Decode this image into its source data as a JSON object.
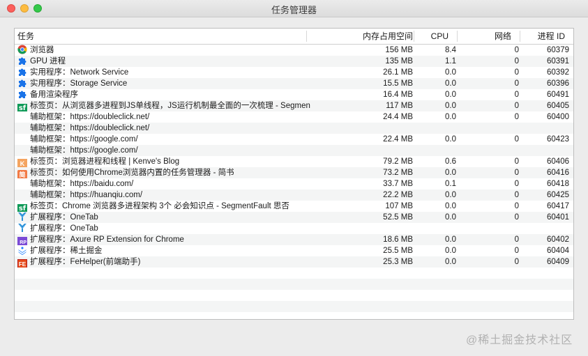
{
  "window": {
    "title": "任务管理器"
  },
  "columns": {
    "task": "任务",
    "memory": "内存占用空间",
    "cpu": "CPU",
    "network": "网络",
    "pid": "进程 ID"
  },
  "rows": [
    {
      "icon": "chrome-icon",
      "task": "浏览器",
      "memory": "156 MB",
      "cpu": "8.4",
      "network": "0",
      "pid": "60379"
    },
    {
      "icon": "puzzle-icon",
      "task": "GPU 进程",
      "memory": "135 MB",
      "cpu": "1.1",
      "network": "0",
      "pid": "60391"
    },
    {
      "icon": "puzzle-icon",
      "task": "实用程序：Network Service",
      "memory": "26.1 MB",
      "cpu": "0.0",
      "network": "0",
      "pid": "60392"
    },
    {
      "icon": "puzzle-icon",
      "task": "实用程序：Storage Service",
      "memory": "15.5 MB",
      "cpu": "0.0",
      "network": "0",
      "pid": "60396"
    },
    {
      "icon": "puzzle-icon",
      "task": "备用渲染程序",
      "memory": "16.4 MB",
      "cpu": "0.0",
      "network": "0",
      "pid": "60491"
    },
    {
      "icon": "sf-icon",
      "task": "标签页：从浏览器多进程到JS单线程，JS运行机制最全面的一次梳理 - Segmen",
      "memory": "117 MB",
      "cpu": "0.0",
      "network": "0",
      "pid": "60405"
    },
    {
      "icon": "",
      "task": "辅助框架：https://doubleclick.net/",
      "memory": "24.4 MB",
      "cpu": "0.0",
      "network": "0",
      "pid": "60400"
    },
    {
      "icon": "",
      "task": "辅助框架：https://doubleclick.net/",
      "memory": "",
      "cpu": "",
      "network": "",
      "pid": ""
    },
    {
      "icon": "",
      "task": "辅助框架：https://google.com/",
      "memory": "22.4 MB",
      "cpu": "0.0",
      "network": "0",
      "pid": "60423"
    },
    {
      "icon": "",
      "task": "辅助框架：https://google.com/",
      "memory": "",
      "cpu": "",
      "network": "",
      "pid": ""
    },
    {
      "icon": "k-icon",
      "task": "标签页：浏览器进程和线程 | Kenve's Blog",
      "memory": "79.2 MB",
      "cpu": "0.6",
      "network": "0",
      "pid": "60406"
    },
    {
      "icon": "jian-icon",
      "task": "标签页：如何使用Chrome浏览器内置的任务管理器 - 简书",
      "memory": "73.2 MB",
      "cpu": "0.0",
      "network": "0",
      "pid": "60416"
    },
    {
      "icon": "",
      "task": "辅助框架：https://baidu.com/",
      "memory": "33.7 MB",
      "cpu": "0.1",
      "network": "0",
      "pid": "60418"
    },
    {
      "icon": "",
      "task": "辅助框架：https://huanqiu.com/",
      "memory": "22.2 MB",
      "cpu": "0.0",
      "network": "0",
      "pid": "60425"
    },
    {
      "icon": "sf-icon",
      "task": "标签页：Chrome 浏览器多进程架构 3个 必会知识点 - SegmentFault 思否",
      "memory": "107 MB",
      "cpu": "0.0",
      "network": "0",
      "pid": "60417"
    },
    {
      "icon": "onetab-icon",
      "task": "扩展程序：OneTab",
      "memory": "52.5 MB",
      "cpu": "0.0",
      "network": "0",
      "pid": "60401"
    },
    {
      "icon": "onetab-icon",
      "task": "扩展程序：OneTab",
      "memory": "",
      "cpu": "",
      "network": "",
      "pid": ""
    },
    {
      "icon": "axure-icon",
      "task": "扩展程序：Axure RP Extension for Chrome",
      "memory": "18.6 MB",
      "cpu": "0.0",
      "network": "0",
      "pid": "60402"
    },
    {
      "icon": "juejin-icon",
      "task": "扩展程序：稀土掘金",
      "memory": "25.5 MB",
      "cpu": "0.0",
      "network": "0",
      "pid": "60404"
    },
    {
      "icon": "fe-icon",
      "task": "扩展程序：FeHelper(前端助手)",
      "memory": "25.3 MB",
      "cpu": "0.0",
      "network": "0",
      "pid": "60409"
    }
  ],
  "icon_text": {
    "sf": "sf",
    "jian": "简",
    "k": "K",
    "rp": "RP",
    "fe": "FE"
  },
  "watermark": "@稀土掘金技术社区",
  "colors": {
    "puzzle": "#1a73e8",
    "sf": "#0e9a57",
    "onetab": "#2a8fd6"
  }
}
